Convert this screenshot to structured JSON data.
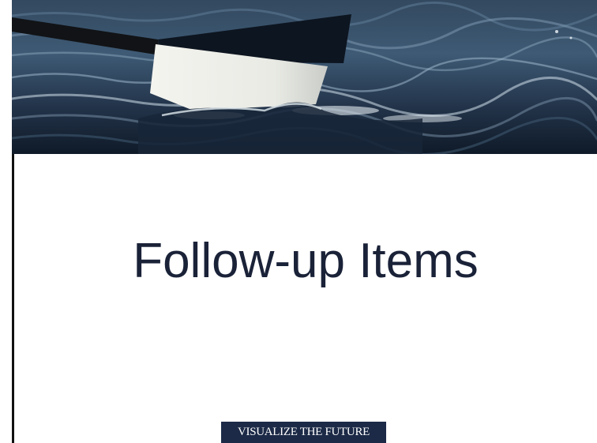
{
  "slide": {
    "title": "Follow-up Items",
    "tagline": "VISUALIZE THE FUTURE"
  },
  "banner": {
    "image": "oar-blade-in-water-photo"
  },
  "colors": {
    "title_text": "#1a2238",
    "tagline_bg": "#1c2a47",
    "tagline_text": "#ffffff",
    "water_dark": "#101b2c",
    "water_light": "#6f8aa4"
  }
}
